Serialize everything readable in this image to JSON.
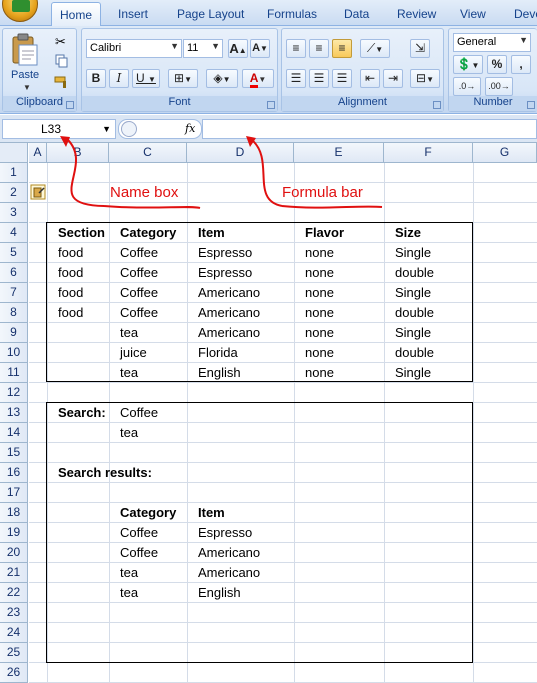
{
  "tabs": [
    {
      "label": "Home",
      "active": true
    },
    {
      "label": "Insert"
    },
    {
      "label": "Page Layout"
    },
    {
      "label": "Formulas"
    },
    {
      "label": "Data"
    },
    {
      "label": "Review"
    },
    {
      "label": "View"
    },
    {
      "label": "Deve"
    }
  ],
  "ribbon": {
    "clipboard": {
      "label": "Clipboard",
      "paste_label": "Paste"
    },
    "font": {
      "label": "Font",
      "font_name": "Calibri",
      "font_size": "11"
    },
    "alignment": {
      "label": "Alignment"
    },
    "number": {
      "label": "Number",
      "format": "General",
      "percent": "%",
      "comma": ","
    }
  },
  "formula_bar": {
    "name_box": "L33",
    "fx": "fx",
    "formula": ""
  },
  "columns": [
    "A",
    "B",
    "C",
    "D",
    "E",
    "F",
    "G"
  ],
  "rows": [
    "1",
    "2",
    "3",
    "4",
    "5",
    "6",
    "7",
    "8",
    "9",
    "10",
    "11",
    "12",
    "13",
    "14",
    "15",
    "16",
    "17",
    "18",
    "19",
    "20",
    "21",
    "22",
    "23",
    "24",
    "25",
    "26"
  ],
  "table1": {
    "headers": [
      "Section",
      "Category",
      "Item",
      "Flavor",
      "Size"
    ],
    "rows": [
      [
        "food",
        "Coffee",
        "Espresso",
        "none",
        "Single"
      ],
      [
        "food",
        "Coffee",
        "Espresso",
        "none",
        "double"
      ],
      [
        "food",
        "Coffee",
        "Americano",
        "none",
        "Single"
      ],
      [
        "food",
        "Coffee",
        "Americano",
        "none",
        "double"
      ],
      [
        "",
        "tea",
        "Americano",
        "none",
        "Single"
      ],
      [
        "",
        "juice",
        "Florida",
        "none",
        "double"
      ],
      [
        "",
        "tea",
        "English",
        "none",
        "Single"
      ]
    ]
  },
  "search": {
    "label": "Search:",
    "terms": [
      "Coffee",
      "tea"
    ],
    "results_label": "Search results:",
    "results_headers": [
      "Category",
      "Item"
    ],
    "results": [
      [
        "Coffee",
        "Espresso"
      ],
      [
        "Coffee",
        "Americano"
      ],
      [
        "tea",
        "Americano"
      ],
      [
        "tea",
        "English"
      ]
    ]
  },
  "annotations": {
    "name_box": "Name box",
    "formula_bar": "Formula bar"
  },
  "colors": {
    "annotation": "#e01010",
    "ribbon": "#dbe6f4",
    "header_text": "#15306b"
  }
}
